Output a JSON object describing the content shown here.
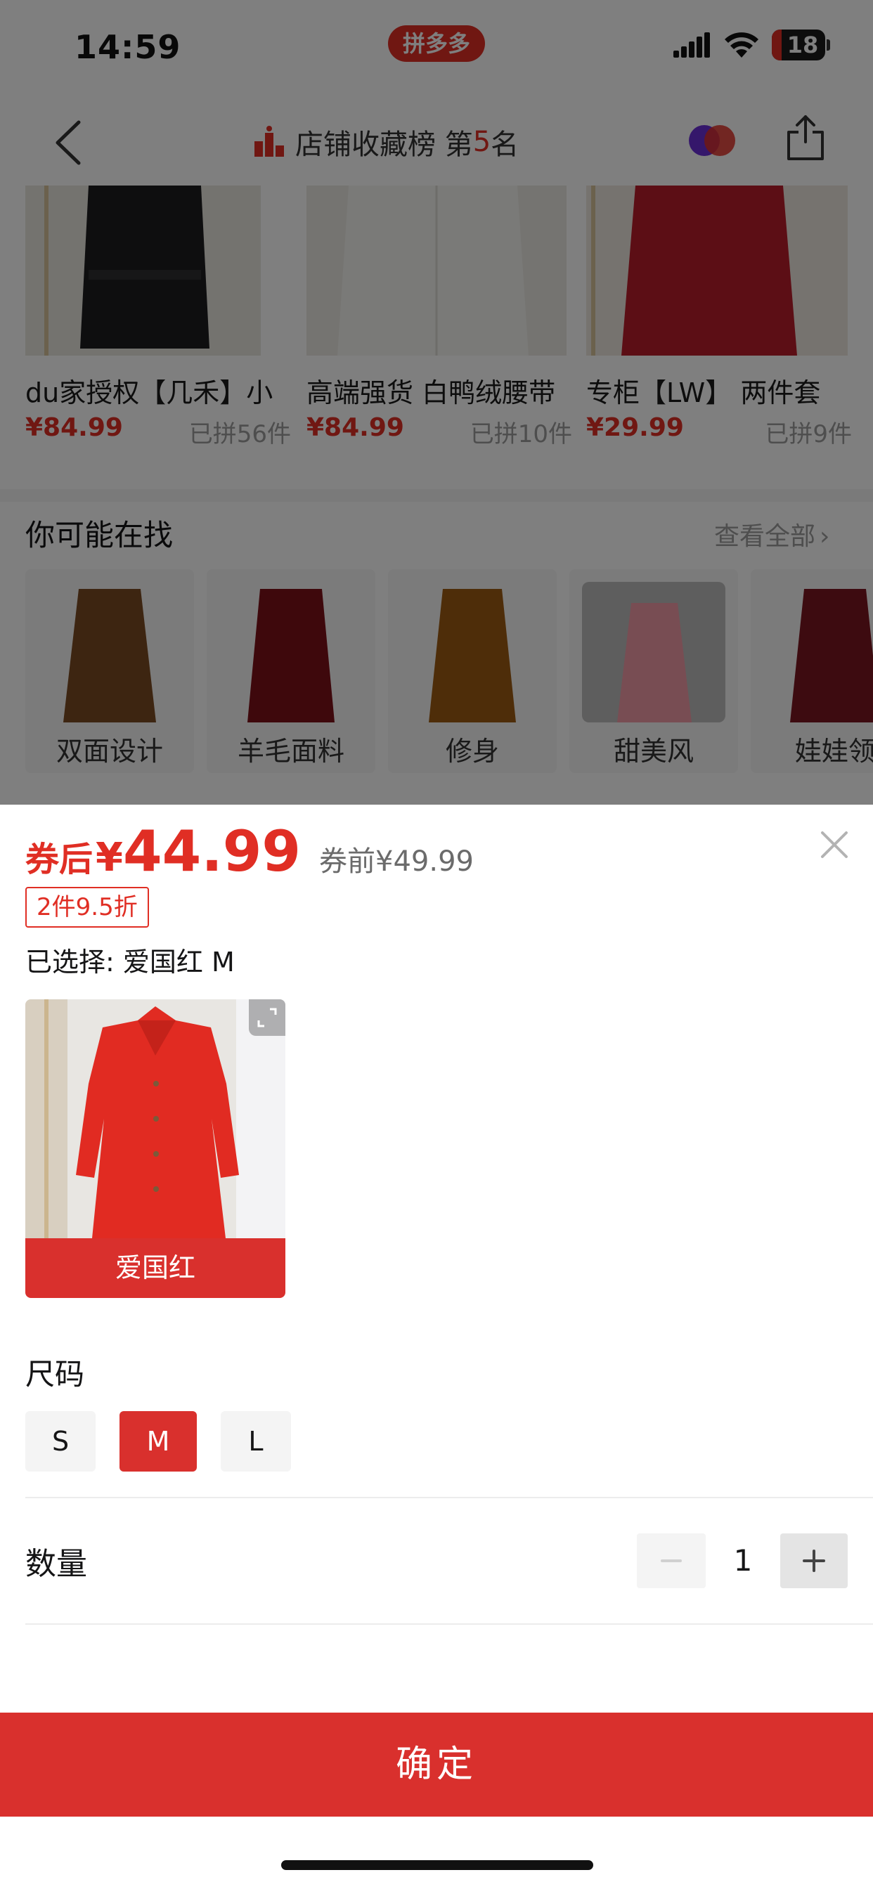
{
  "status_bar": {
    "time": "14:59",
    "app_badge": "拼多多",
    "battery": "18"
  },
  "nav": {
    "rank_label": "店铺收藏榜 第",
    "rank_number": "5",
    "rank_suffix": "名"
  },
  "products": [
    {
      "name": "du家授权【几禾】小",
      "price": "¥84.99",
      "sold": "已拼56件"
    },
    {
      "name": "高端强货 白鸭绒腰带",
      "price": "¥84.99",
      "sold": "已拼10件"
    },
    {
      "name": "专柜【LW】 两件套",
      "price": "¥29.99",
      "sold": "已拼9件"
    }
  ],
  "maybe_looking": {
    "title": "你可能在找",
    "view_all": "查看全部",
    "items": [
      {
        "label": "双面设计"
      },
      {
        "label": "羊毛面料"
      },
      {
        "label": "修身"
      },
      {
        "label": "甜美风"
      },
      {
        "label": "娃娃领"
      }
    ]
  },
  "sheet": {
    "price_prefix": "券后",
    "currency": "¥",
    "price": "44.99",
    "original_price": "券前¥49.99",
    "promo_tag": "2件9.5折",
    "selected_text": "已选择: 爱国红 M",
    "color_option": "爱国红",
    "size_title": "尺码",
    "sizes": [
      "S",
      "M",
      "L"
    ],
    "selected_size": "M",
    "quantity_label": "数量",
    "quantity": "1",
    "confirm_label": "确定"
  },
  "colors": {
    "accent": "#d9302d",
    "brand_red": "#e02e24"
  }
}
